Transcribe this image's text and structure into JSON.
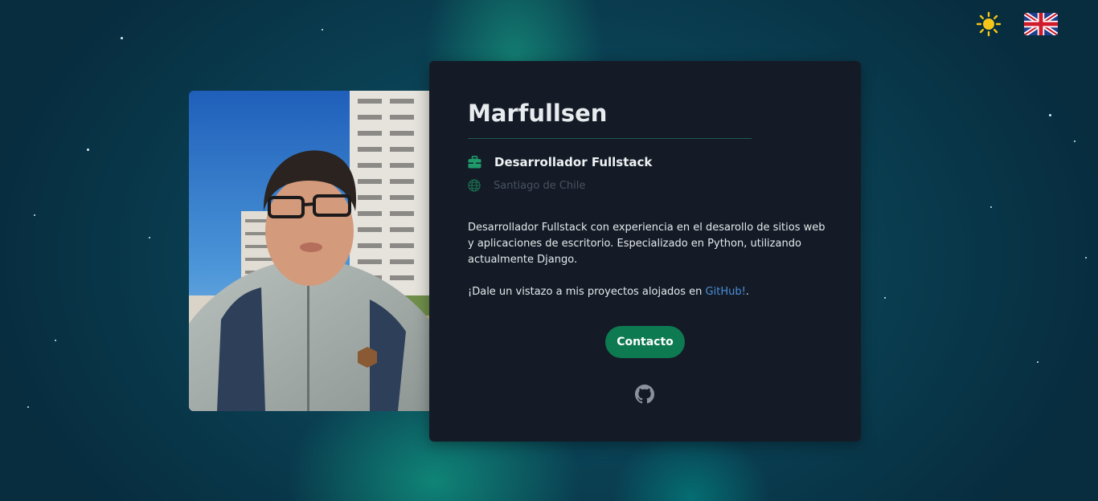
{
  "profile": {
    "name": "Marfullsen",
    "role": "Desarrollador Fullstack",
    "location": "Santiago de Chile",
    "description": "Desarrollador Fullstack con experiencia en el desarollo de sitios web y aplicaciones de escritorio. Especializado en Python, utilizando actualmente Django.",
    "projects_prefix": "¡Dale un vistazo a mis proyectos alojados en ",
    "projects_link": "GitHub!",
    "projects_suffix": "."
  },
  "buttons": {
    "contact": "Contacto"
  },
  "icons": {
    "theme": "sun-icon",
    "language": "uk-flag-icon",
    "role": "briefcase-icon",
    "location": "globe-icon",
    "social": "github-icon"
  },
  "colors": {
    "accent_green": "#0e7a52",
    "link_blue": "#4a8fd9",
    "card_bg": "#141b26",
    "sun_yellow": "#f5c518"
  }
}
